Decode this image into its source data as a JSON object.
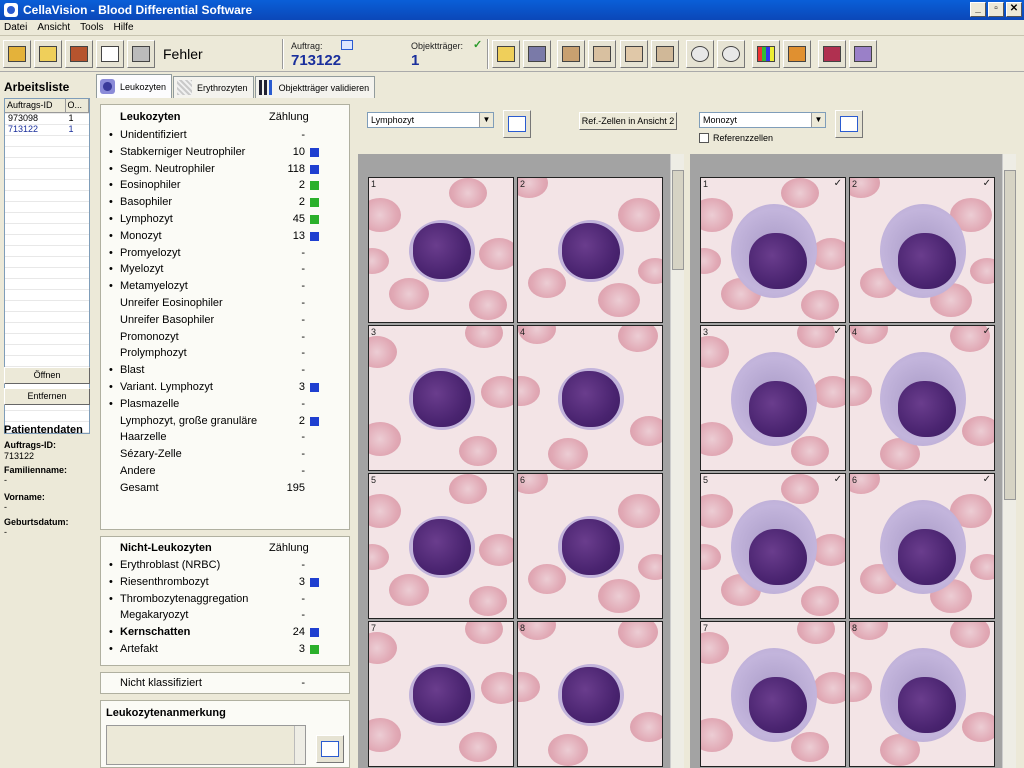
{
  "window": {
    "title": "CellaVision - Blood Differential Software",
    "minimize": "_",
    "restore": "▫",
    "close": "✕"
  },
  "menu": [
    "Datei",
    "Ansicht",
    "Tools",
    "Hilfe"
  ],
  "toolbar": {
    "status": "Fehler",
    "auftrag_label": "Auftrag:",
    "auftrag_value": "713122",
    "objekttraeger_label": "Objektträger:",
    "objekttraeger_value": "1",
    "check": "✓"
  },
  "worklist": {
    "title": "Arbeitsliste",
    "headers": [
      "Auftrags-ID",
      "O..."
    ],
    "rows": [
      {
        "id": "973098",
        "o": "1"
      },
      {
        "id": "713122",
        "o": "1"
      }
    ],
    "open_button": "Öffnen",
    "remove_button": "Entfernen"
  },
  "patient": {
    "title": "Patientendaten",
    "auftrags_id_label": "Auftrags-ID:",
    "auftrags_id": "713122",
    "familienname_label": "Familienname:",
    "familienname": "-",
    "vorname_label": "Vorname:",
    "vorname": "-",
    "geburtsdatum_label": "Geburtsdatum:",
    "geburtsdatum": "-"
  },
  "tabs": [
    "Leukozyten",
    "Erythrozyten",
    "Objektträger validieren"
  ],
  "leukozyten": {
    "title": "Leukozyten",
    "count_header": "Zählung",
    "rows": [
      {
        "bullet": "•",
        "name": "Unidentifiziert",
        "count": "-",
        "color": ""
      },
      {
        "bullet": "•",
        "name": "Stabkerniger Neutrophiler",
        "count": "10",
        "color": "#1f3fd0"
      },
      {
        "bullet": "•",
        "name": "Segm. Neutrophiler",
        "count": "118",
        "color": "#1f3fd0"
      },
      {
        "bullet": "•",
        "name": "Eosinophiler",
        "count": "2",
        "color": "#2bb02b"
      },
      {
        "bullet": "•",
        "name": "Basophiler",
        "count": "2",
        "color": "#2bb02b"
      },
      {
        "bullet": "•",
        "name": "Lymphozyt",
        "count": "45",
        "color": "#2bb02b"
      },
      {
        "bullet": "•",
        "name": "Monozyt",
        "count": "13",
        "color": "#1f3fd0"
      },
      {
        "bullet": "•",
        "name": "Promyelozyt",
        "count": "-",
        "color": ""
      },
      {
        "bullet": "•",
        "name": "Myelozyt",
        "count": "-",
        "color": ""
      },
      {
        "bullet": "•",
        "name": "Metamyelozyt",
        "count": "-",
        "color": ""
      },
      {
        "bullet": "",
        "name": "Unreifer Eosinophiler",
        "count": "-",
        "color": ""
      },
      {
        "bullet": "",
        "name": "Unreifer Basophiler",
        "count": "-",
        "color": ""
      },
      {
        "bullet": "",
        "name": "Promonozyt",
        "count": "-",
        "color": ""
      },
      {
        "bullet": "",
        "name": "Prolymphozyt",
        "count": "-",
        "color": ""
      },
      {
        "bullet": "•",
        "name": "Blast",
        "count": "-",
        "color": ""
      },
      {
        "bullet": "•",
        "name": "Variant. Lymphozyt",
        "count": "3",
        "color": "#1f3fd0"
      },
      {
        "bullet": "•",
        "name": "Plasmazelle",
        "count": "-",
        "color": ""
      },
      {
        "bullet": "",
        "name": "Lymphozyt, große granuläre",
        "count": "2",
        "color": "#1f3fd0"
      },
      {
        "bullet": "",
        "name": "Haarzelle",
        "count": "-",
        "color": ""
      },
      {
        "bullet": "",
        "name": "Sézary-Zelle",
        "count": "-",
        "color": ""
      },
      {
        "bullet": "",
        "name": "Andere",
        "count": "-",
        "color": ""
      },
      {
        "bullet": "",
        "name": "Gesamt",
        "count": "195",
        "color": ""
      }
    ]
  },
  "nicht_leukozyten": {
    "title": "Nicht-Leukozyten",
    "count_header": "Zählung",
    "rows": [
      {
        "bullet": "•",
        "name": "Erythroblast (NRBC)",
        "count": "-",
        "color": "",
        "bold": false
      },
      {
        "bullet": "•",
        "name": "Riesenthrombozyt",
        "count": "3",
        "color": "#1f3fd0",
        "bold": false
      },
      {
        "bullet": "•",
        "name": "Thrombozytenaggregation",
        "count": "-",
        "color": "",
        "bold": false
      },
      {
        "bullet": "",
        "name": "Megakaryozyt",
        "count": "-",
        "color": "",
        "bold": false
      },
      {
        "bullet": "•",
        "name": "Kernschatten",
        "count": "24",
        "color": "#1f3fd0",
        "bold": true
      },
      {
        "bullet": "•",
        "name": "Artefakt",
        "count": "3",
        "color": "#2bb02b",
        "bold": false
      }
    ]
  },
  "nicht_klassifiziert": {
    "name": "Nicht klassifiziert",
    "count": "-"
  },
  "anmerkung": {
    "title": "Leukozytenanmerkung"
  },
  "viewer_left": {
    "cell_type": "Lymphozyt",
    "ref_button": "Ref.-Zellen in Ansicht 2",
    "cells": [
      "1",
      "2",
      "3",
      "4",
      "5",
      "6",
      "7",
      "8"
    ]
  },
  "viewer_right": {
    "cell_type": "Monozyt",
    "ref_checkbox": "Referenzzellen",
    "cells": [
      "1",
      "2",
      "3",
      "4",
      "5",
      "6",
      "7",
      "8"
    ],
    "tick": "✓"
  }
}
